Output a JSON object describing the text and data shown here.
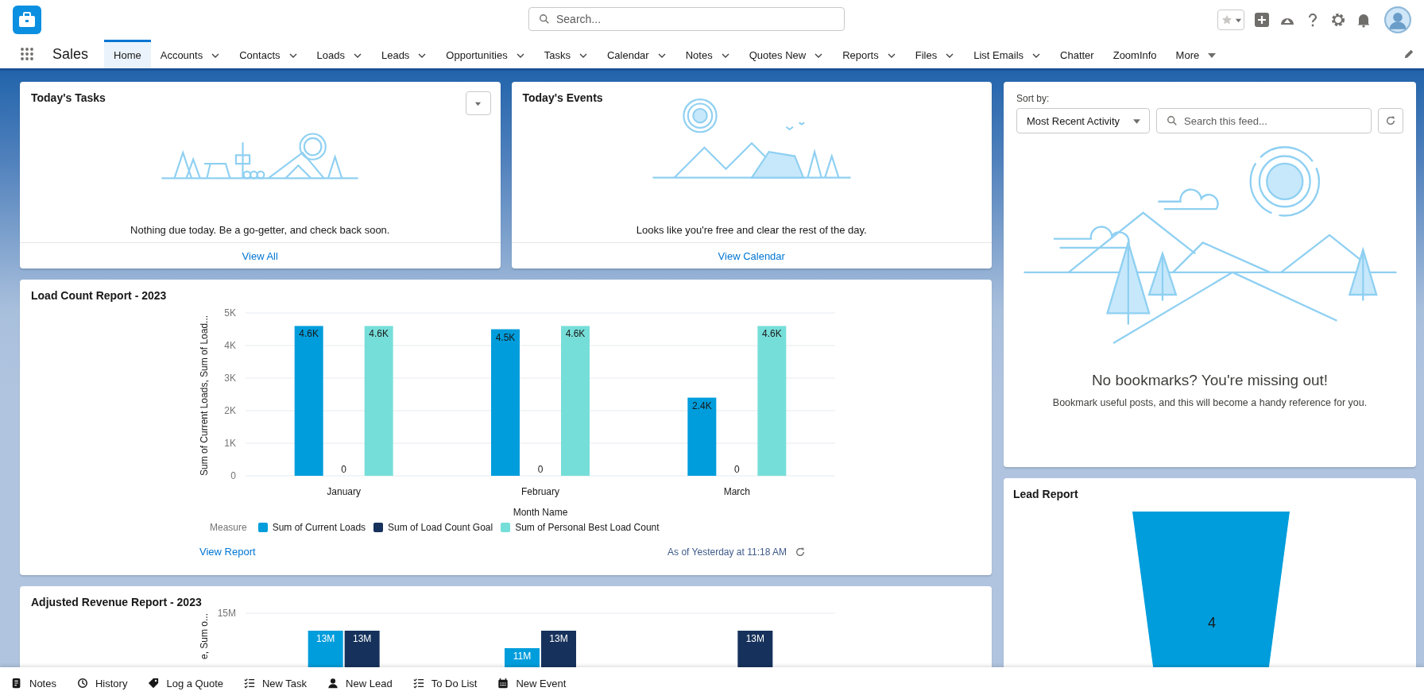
{
  "header": {
    "search": {
      "placeholder": "Search..."
    }
  },
  "app_name": "Sales",
  "nav": [
    {
      "label": "Home",
      "selected": true,
      "dropdown": false
    },
    {
      "label": "Accounts",
      "selected": false,
      "dropdown": true
    },
    {
      "label": "Contacts",
      "selected": false,
      "dropdown": true
    },
    {
      "label": "Loads",
      "selected": false,
      "dropdown": true
    },
    {
      "label": "Leads",
      "selected": false,
      "dropdown": true
    },
    {
      "label": "Opportunities",
      "selected": false,
      "dropdown": true
    },
    {
      "label": "Tasks",
      "selected": false,
      "dropdown": true
    },
    {
      "label": "Calendar",
      "selected": false,
      "dropdown": true
    },
    {
      "label": "Notes",
      "selected": false,
      "dropdown": true
    },
    {
      "label": "Quotes New",
      "selected": false,
      "dropdown": true
    },
    {
      "label": "Reports",
      "selected": false,
      "dropdown": true
    },
    {
      "label": "Files",
      "selected": false,
      "dropdown": true
    },
    {
      "label": "List Emails",
      "selected": false,
      "dropdown": true
    },
    {
      "label": "Chatter",
      "selected": false,
      "dropdown": false
    },
    {
      "label": "ZoomInfo",
      "selected": false,
      "dropdown": false
    }
  ],
  "more_menu": {
    "label": "More"
  },
  "tasks_card": {
    "title": "Today's Tasks",
    "message": "Nothing due today. Be a go-getter, and check back soon.",
    "link": "View All"
  },
  "events_card": {
    "title": "Today's Events",
    "message": "Looks like you're free and clear the rest of the day.",
    "link": "View Calendar"
  },
  "load_report": {
    "title": "Load Count Report - 2023",
    "legend_title": "Measure",
    "link": "View Report",
    "timestamp": "As of Yesterday at 11:18 AM",
    "chart_data": {
      "type": "bar",
      "xlabel": "Month Name",
      "ylabel": "Sum of Current Loads, Sum of Load...",
      "categories": [
        "January",
        "February",
        "March"
      ],
      "ylim": [
        0,
        5000
      ],
      "grid": true,
      "yticks": [
        {
          "value": 0,
          "label": "0"
        },
        {
          "value": 1000,
          "label": "1K"
        },
        {
          "value": 2000,
          "label": "2K"
        },
        {
          "value": 3000,
          "label": "3K"
        },
        {
          "value": 4000,
          "label": "4K"
        },
        {
          "value": 5000,
          "label": "5K"
        }
      ],
      "series": [
        {
          "name": "Sum of Current Loads",
          "color": "#009ddc",
          "values": [
            4600,
            4500,
            2400
          ],
          "value_labels": [
            "4.6K",
            "4.5K",
            "2.4K"
          ]
        },
        {
          "name": "Sum of Load Count Goal",
          "color": "#16325c",
          "values": [
            0,
            0,
            0
          ],
          "value_labels": [
            "0",
            "0",
            "0"
          ]
        },
        {
          "name": "Sum of Personal Best Load Count",
          "color": "#76ded9",
          "values": [
            4600,
            4600,
            4600
          ],
          "value_labels": [
            "4.6K",
            "4.6K",
            "4.6K"
          ]
        }
      ]
    }
  },
  "revenue_report": {
    "title": "Adjusted Revenue Report - 2023",
    "chart_data": {
      "type": "bar",
      "ylabel": "e, Sum o...",
      "ylim": [
        0,
        15000000
      ],
      "yticks": [
        {
          "value": 15000000,
          "label": "15M"
        }
      ],
      "series": [
        {
          "color": "#009ddc",
          "values": [
            13000000,
            11000000,
            null
          ],
          "value_labels": [
            "13M",
            "11M",
            null
          ]
        },
        {
          "color": "#16325c",
          "values": [
            13000000,
            13000000,
            13000000
          ],
          "value_labels": [
            "13M",
            "13M",
            "13M"
          ]
        }
      ]
    }
  },
  "feed": {
    "sort_label": "Sort by:",
    "sort_value": "Most Recent Activity",
    "search": {
      "placeholder": "Search this feed..."
    },
    "empty_title": "No bookmarks? You're missing out!",
    "empty_text": "Bookmark useful posts, and this will become a handy reference for you."
  },
  "lead_report": {
    "title": "Lead Report",
    "funnel_value": "4"
  },
  "utility_bar": [
    {
      "label": "Notes",
      "kind": "notes"
    },
    {
      "label": "History",
      "kind": "history"
    },
    {
      "label": "Log a Quote",
      "kind": "tag"
    },
    {
      "label": "New Task",
      "kind": "checklist"
    },
    {
      "label": "New Lead",
      "kind": "person"
    },
    {
      "label": "To Do List",
      "kind": "checklist"
    },
    {
      "label": "New Event",
      "kind": "calendar"
    }
  ]
}
